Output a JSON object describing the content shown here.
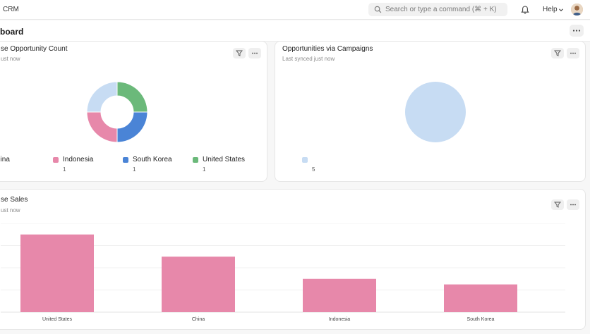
{
  "app": {
    "title": "CRM"
  },
  "search": {
    "placeholder": "Search or type a command (⌘ + K)"
  },
  "header": {
    "help_label": "Help",
    "page_title": "board"
  },
  "colors": {
    "pink": "#e788aa",
    "blue": "#4a84d6",
    "green": "#6bb97a",
    "light_blue": "#c7dcf3"
  },
  "cards": {
    "donut": {
      "title": "se Opportunity Count",
      "subtitle": "ust now",
      "legend": [
        {
          "name": "hina",
          "value": "",
          "color": "#c7dcf3"
        },
        {
          "name": "Indonesia",
          "value": "1",
          "color": "#e788aa"
        },
        {
          "name": "South Korea",
          "value": "1",
          "color": "#4a84d6"
        },
        {
          "name": "United States",
          "value": "1",
          "color": "#6bb97a"
        }
      ]
    },
    "campaigns": {
      "title": "Opportunities via Campaigns",
      "subtitle": "Last synced just now",
      "legend": [
        {
          "name": "",
          "value": "5",
          "color": "#c7dcf3"
        }
      ]
    },
    "sales": {
      "title": "se Sales",
      "subtitle": "ust now"
    }
  },
  "chart_data": [
    {
      "type": "pie",
      "donut": true,
      "categories": [
        "United States",
        "South Korea",
        "Indonesia",
        "China"
      ],
      "values": [
        1,
        1,
        1,
        1
      ],
      "colors": [
        "#6bb97a",
        "#4a84d6",
        "#e788aa",
        "#c7dcf3"
      ]
    },
    {
      "type": "pie",
      "categories": [
        ""
      ],
      "values": [
        5
      ],
      "colors": [
        "#c7dcf3"
      ]
    },
    {
      "type": "bar",
      "categories": [
        "United States",
        "China",
        "Indonesia",
        "South Korea"
      ],
      "values": [
        7,
        5,
        3,
        2.5
      ],
      "ylim": [
        0,
        8
      ],
      "color": "#e788aa",
      "grid": true
    }
  ]
}
